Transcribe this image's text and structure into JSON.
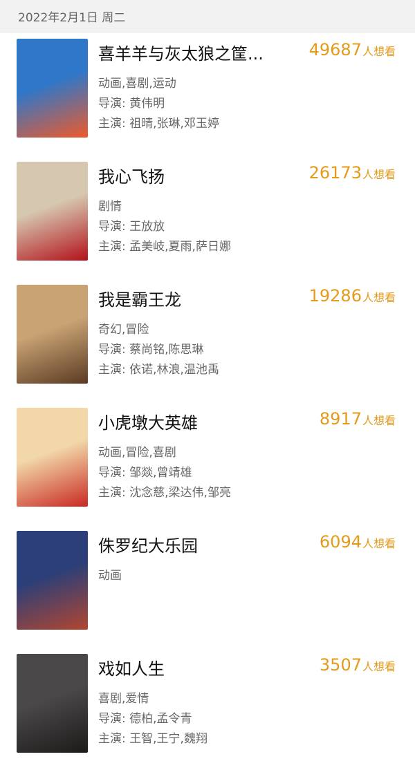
{
  "date_header": "2022年2月1日 周二",
  "movies": [
    {
      "title": "喜羊羊与灰太狼之筐...",
      "count": "49687",
      "suffix": "人想看",
      "genre": "动画,喜剧,运动",
      "director": "导演: 黄伟明",
      "cast": "主演: 祖晴,张琳,邓玉婷",
      "poster_colors": [
        "#2f77c9",
        "#ee5a2a"
      ]
    },
    {
      "title": "我心飞扬",
      "count": "26173",
      "suffix": "人想看",
      "genre": "剧情",
      "director": "导演: 王放放",
      "cast": "主演: 孟美岐,夏雨,萨日娜",
      "poster_colors": [
        "#d6c7b0",
        "#b3111a"
      ]
    },
    {
      "title": "我是霸王龙",
      "count": "19286",
      "suffix": "人想看",
      "genre": "奇幻,冒险",
      "director": "导演: 蔡尚铭,陈思琳",
      "cast": "主演: 依诺,林浪,温池禹",
      "poster_colors": [
        "#c9a374",
        "#5a3a22"
      ]
    },
    {
      "title": "小虎墩大英雄",
      "count": "8917",
      "suffix": "人想看",
      "genre": "动画,冒险,喜剧",
      "director": "导演: 邹燚,曾靖雄",
      "cast": "主演: 沈念慈,梁达伟,邹亮",
      "poster_colors": [
        "#f2d7a8",
        "#c92a23"
      ]
    },
    {
      "title": "侏罗纪大乐园",
      "count": "6094",
      "suffix": "人想看",
      "genre": "动画",
      "director": "",
      "cast": "",
      "poster_colors": [
        "#2c3f78",
        "#b24630"
      ]
    },
    {
      "title": "戏如人生",
      "count": "3507",
      "suffix": "人想看",
      "genre": "喜剧,爱情",
      "director": "导演: 德柏,孟令青",
      "cast": "主演: 王智,王宁,魏翔",
      "poster_colors": [
        "#4a4848",
        "#1d1a1a"
      ]
    }
  ]
}
